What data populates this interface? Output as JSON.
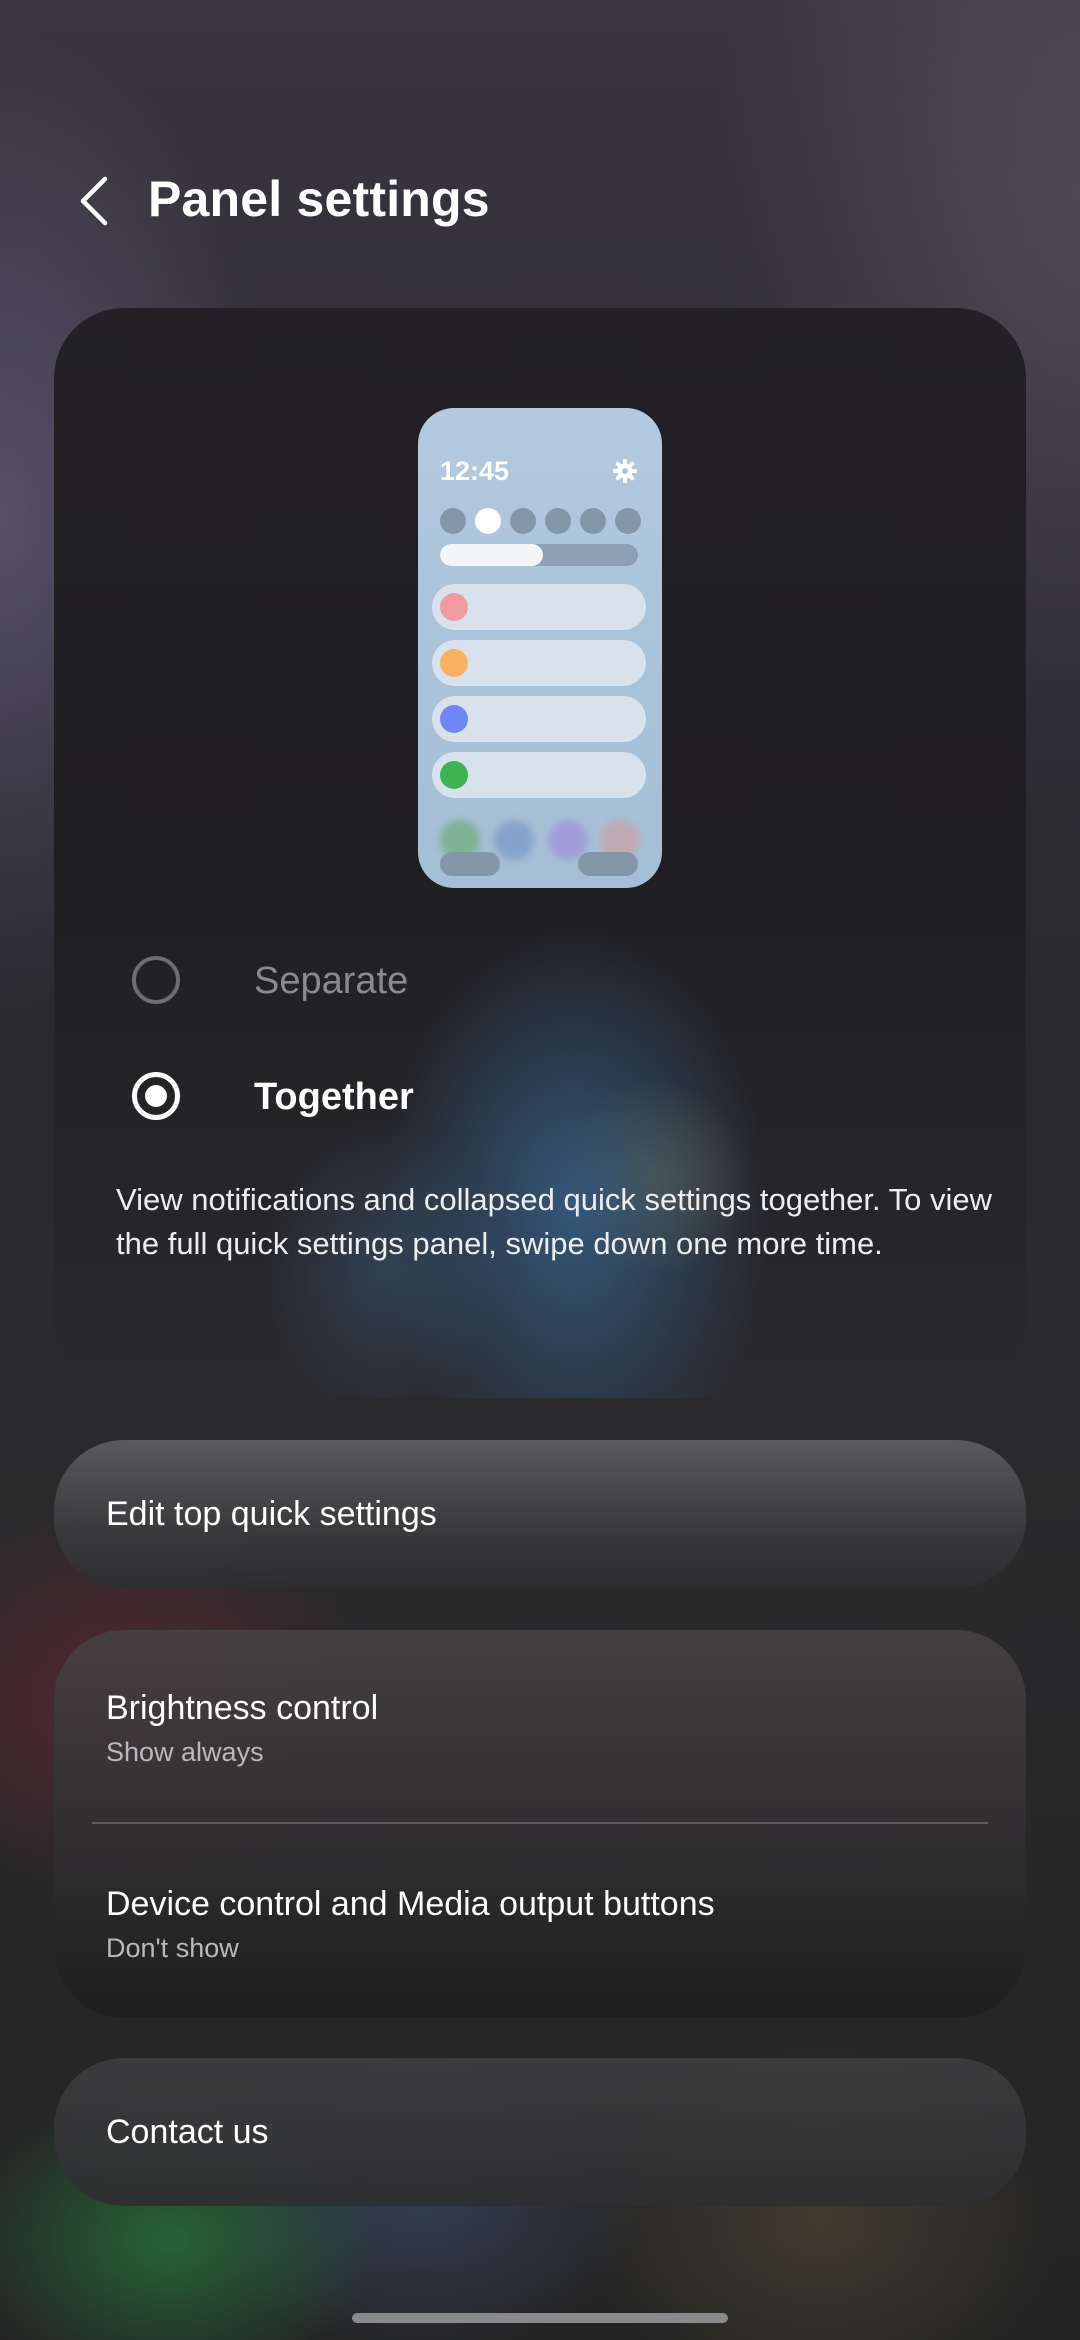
{
  "header": {
    "title": "Panel settings",
    "back_icon": "chevron-left-icon"
  },
  "preview": {
    "time": "12:45",
    "gear_icon": "gear-icon",
    "brightness_level": 0.52,
    "quick_toggle_active_index": 1,
    "row_dot_colors": [
      "#f19aa0",
      "#f7b160",
      "#6f86f3",
      "#3db351"
    ]
  },
  "options": {
    "separate_label": "Separate",
    "together_label": "Together",
    "selected": "Together"
  },
  "description": "View notifications and collapsed quick settings together. To view the full quick settings panel, swipe down one more time.",
  "settings": {
    "edit_top_quick_settings": "Edit top quick settings",
    "brightness_control": {
      "title": "Brightness control",
      "value": "Show always"
    },
    "device_control": {
      "title": "Device control and Media output buttons",
      "value": "Don't show"
    },
    "contact_us": "Contact us"
  }
}
